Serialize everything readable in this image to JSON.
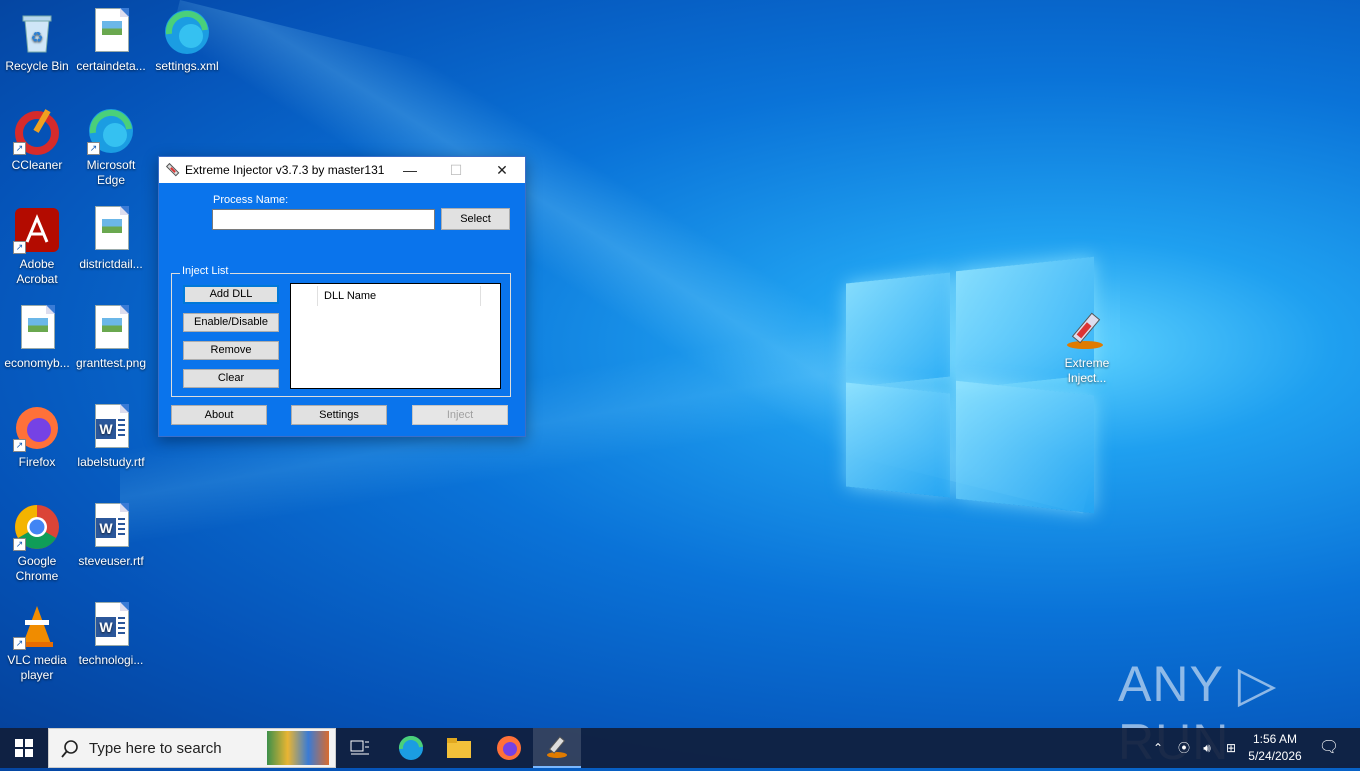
{
  "desktop": {
    "icons": [
      {
        "label": "Recycle Bin"
      },
      {
        "label": "certaindeta..."
      },
      {
        "label": "settings.xml"
      },
      {
        "label": "CCleaner"
      },
      {
        "label": "Microsoft Edge"
      },
      {
        "label": "Adobe Acrobat"
      },
      {
        "label": "districtdail..."
      },
      {
        "label": "economyb..."
      },
      {
        "label": "granttest.png"
      },
      {
        "label": "Firefox"
      },
      {
        "label": "labelstudy.rtf"
      },
      {
        "label": "Google Chrome"
      },
      {
        "label": "steveuser.rtf"
      },
      {
        "label": "VLC media player"
      },
      {
        "label": "technologi..."
      },
      {
        "label": "Extreme Inject..."
      }
    ],
    "watermark": "ANY ▷ RUN"
  },
  "window": {
    "title": "Extreme Injector v3.7.3 by master131",
    "controls": {
      "minimize": "—",
      "maximize": "☐",
      "close": "✕"
    },
    "process_label": "Process Name:",
    "process_value": "",
    "select_label": "Select",
    "inject_list_label": "Inject List",
    "buttons": {
      "add_dll": "Add DLL",
      "enable_disable": "Enable/Disable",
      "remove": "Remove",
      "clear": "Clear",
      "about": "About",
      "settings": "Settings",
      "inject": "Inject"
    },
    "dll_column": "DLL Name"
  },
  "taskbar": {
    "search_placeholder": "Type here to search",
    "time": "1:56 AM",
    "date": "5/24/2026"
  }
}
